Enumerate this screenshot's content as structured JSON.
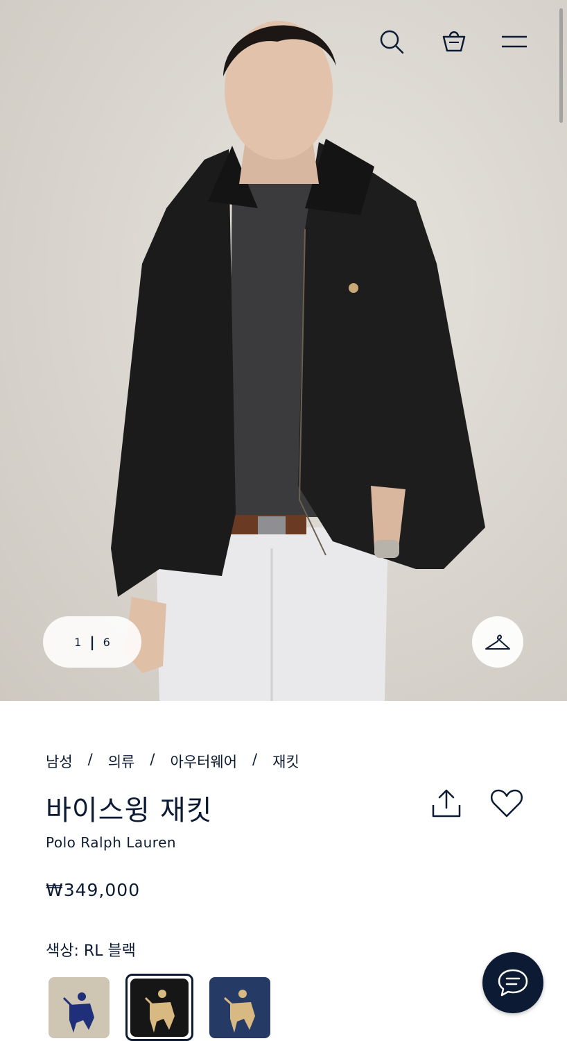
{
  "gallery": {
    "current": "1",
    "separator": "|",
    "total": "6"
  },
  "breadcrumb": [
    "남성",
    "의류",
    "아우터웨어",
    "재킷"
  ],
  "breadcrumb_separator": "/",
  "product": {
    "title": "바이스윙 재킷",
    "brand": "Polo Ralph Lauren",
    "price": "₩349,000"
  },
  "color": {
    "label": "색상:",
    "value": "RL 블랙"
  },
  "swatches": [
    {
      "name": "tan",
      "bg": "#cfc5b3",
      "pony": "#1f2f7a"
    },
    {
      "name": "rl-black",
      "bg": "#161616",
      "pony": "#d8b982",
      "selected": true
    },
    {
      "name": "navy",
      "bg": "#263a66",
      "pony": "#d8b982"
    }
  ],
  "icons": {
    "search": "search-icon",
    "bag": "shopping-bag-icon",
    "menu": "menu-icon",
    "hanger": "hanger-icon",
    "share": "share-icon",
    "wishlist": "heart-icon",
    "chat": "chat-icon"
  },
  "colors": {
    "navy": "#0c1b33",
    "white": "#ffffff"
  }
}
